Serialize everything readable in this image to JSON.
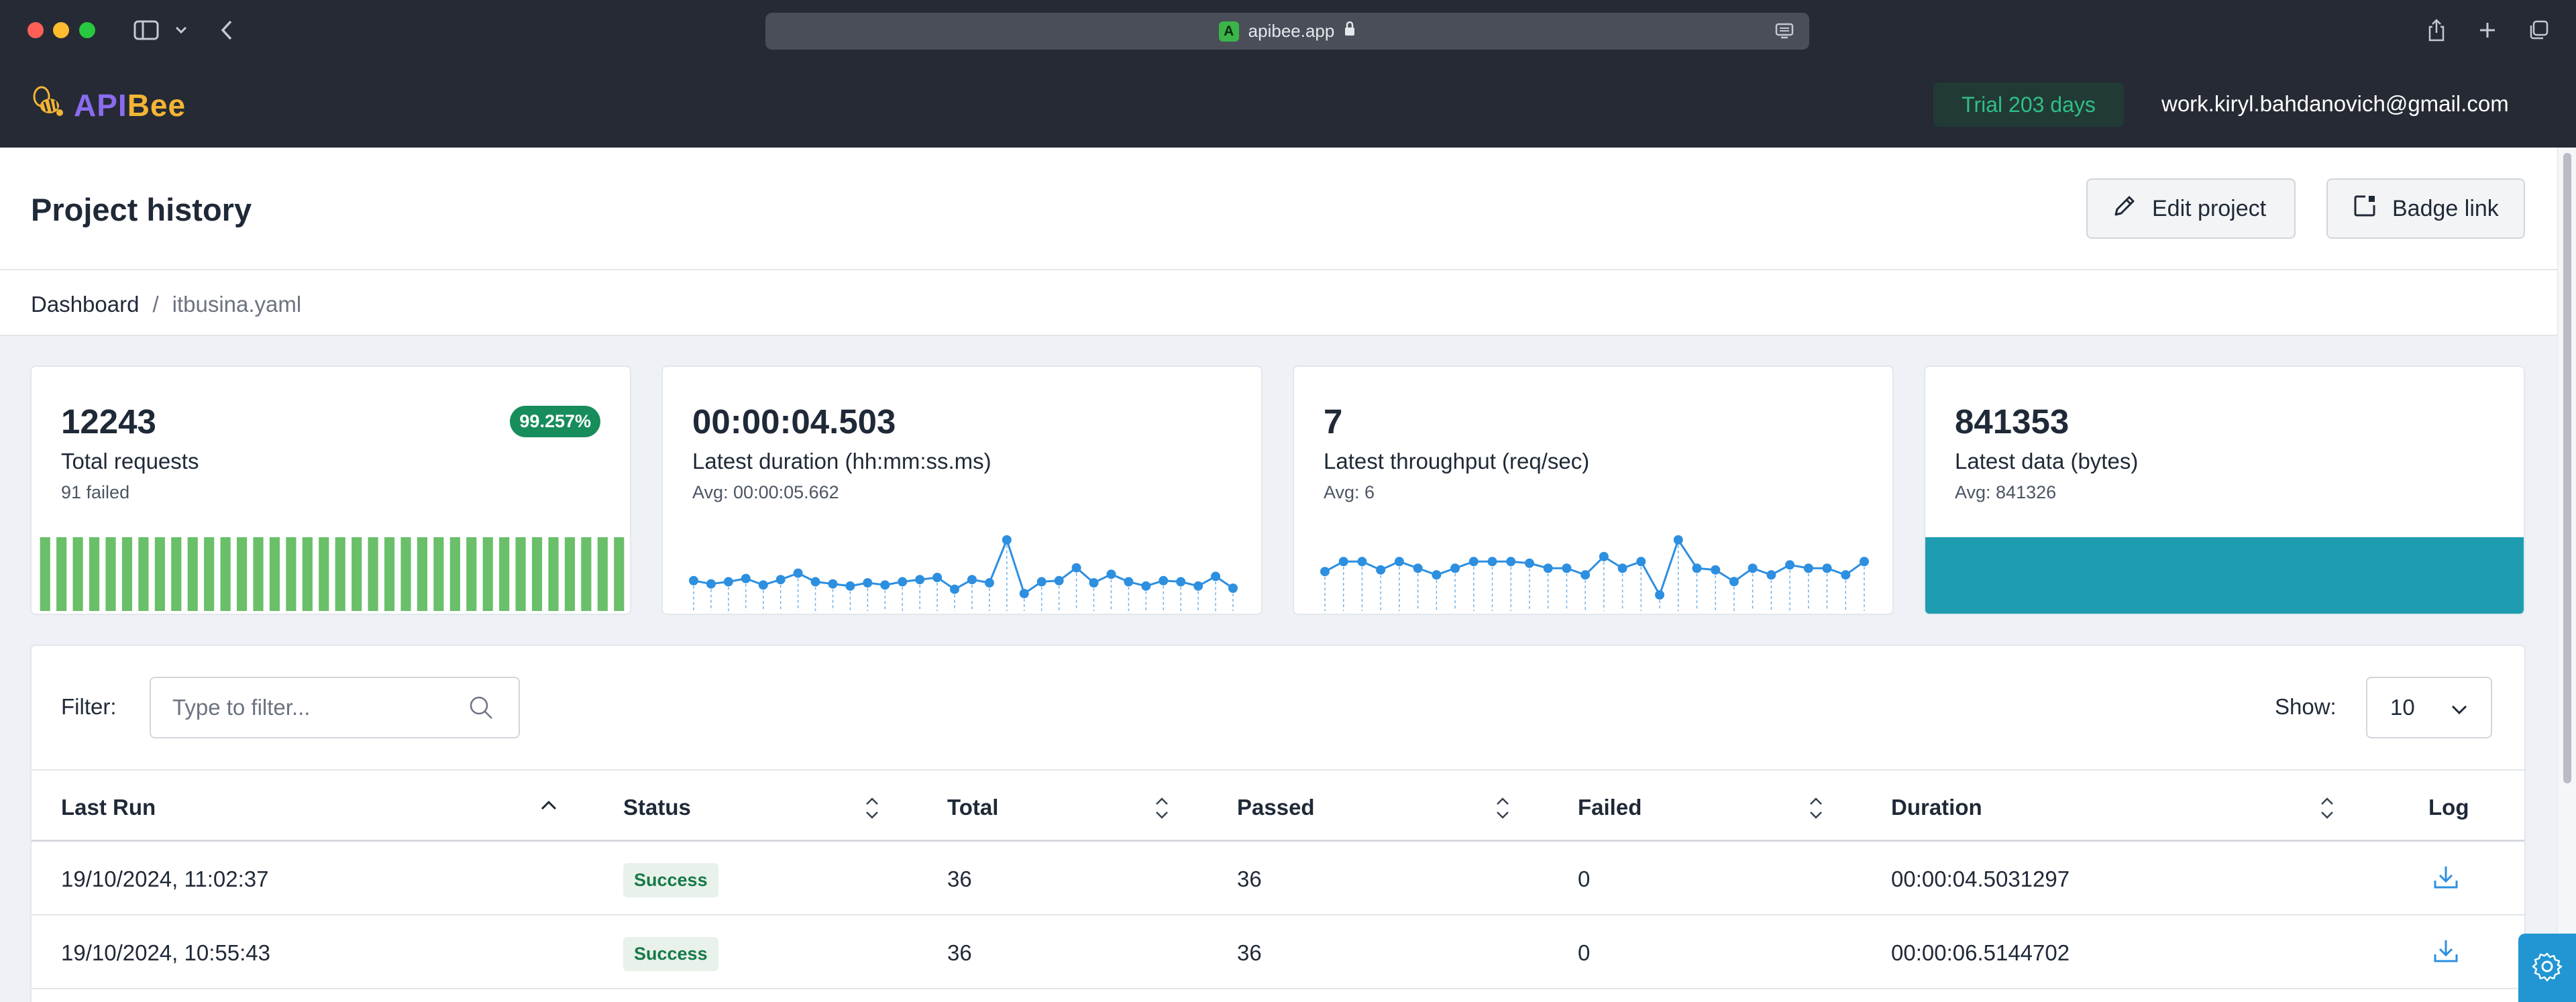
{
  "browser": {
    "url": "apibee.app",
    "site_badge": "A"
  },
  "app": {
    "logo_api": "API",
    "logo_bee": "Bee",
    "trial": "Trial 203 days",
    "email": "work.kiryl.bahdanovich@gmail.com"
  },
  "page": {
    "title": "Project history",
    "edit_label": "Edit project",
    "badge_label": "Badge link"
  },
  "breadcrumb": {
    "home": "Dashboard",
    "sep": "/",
    "current": "itbusina.yaml"
  },
  "cards": {
    "requests": {
      "value": "12243",
      "label": "Total requests",
      "sub": "91 failed",
      "badge": "99.257%"
    },
    "duration": {
      "value": "00:00:04.503",
      "label": "Latest duration (hh:mm:ss.ms)",
      "sub": "Avg: 00:00:05.662"
    },
    "throughput": {
      "value": "7",
      "label": "Latest throughput (req/sec)",
      "sub": "Avg: 6"
    },
    "data": {
      "value": "841353",
      "label": "Latest data (bytes)",
      "sub": "Avg: 841326"
    }
  },
  "chart_data": [
    {
      "type": "bar",
      "name": "requests",
      "values": [
        1,
        1,
        1,
        1,
        1,
        1,
        1,
        1,
        1,
        1,
        1,
        1,
        1,
        1,
        1,
        1,
        1,
        1,
        1,
        1,
        1,
        1,
        1,
        1,
        1,
        1,
        1,
        1,
        1,
        1,
        1,
        1,
        1,
        1,
        1,
        1
      ],
      "color": "#6abf69"
    },
    {
      "type": "line",
      "name": "duration",
      "values": [
        5.2,
        4.9,
        5.1,
        5.4,
        4.8,
        5.3,
        5.9,
        5.1,
        4.9,
        4.7,
        5.0,
        4.8,
        5.1,
        5.3,
        5.5,
        4.4,
        5.3,
        5.0,
        9.0,
        4.0,
        5.1,
        5.2,
        6.4,
        5.0,
        5.8,
        5.1,
        4.7,
        5.2,
        5.1,
        4.7,
        5.6,
        4.5
      ],
      "color": "#2d8fe0"
    },
    {
      "type": "line",
      "name": "throughput",
      "values": [
        6,
        6.6,
        6.6,
        6.1,
        6.6,
        6.2,
        5.8,
        6.2,
        6.6,
        6.6,
        6.6,
        6.5,
        6.2,
        6.2,
        5.8,
        6.9,
        6.2,
        6.6,
        4.6,
        7.9,
        6.2,
        6.1,
        5.4,
        6.2,
        5.8,
        6.4,
        6.2,
        6.2,
        5.8,
        6.6
      ],
      "color": "#2d8fe0"
    }
  ],
  "table": {
    "filter_label": "Filter:",
    "filter_placeholder": "Type to filter...",
    "show_label": "Show:",
    "show_value": "10",
    "columns": [
      "Last Run",
      "Status",
      "Total",
      "Passed",
      "Failed",
      "Duration",
      "Log"
    ],
    "rows": [
      {
        "last_run": "19/10/2024, 11:02:37",
        "status": "Success",
        "total": "36",
        "passed": "36",
        "failed": "0",
        "duration": "00:00:04.5031297"
      },
      {
        "last_run": "19/10/2024, 10:55:43",
        "status": "Success",
        "total": "36",
        "passed": "36",
        "failed": "0",
        "duration": "00:00:06.5144702"
      }
    ]
  },
  "colors": {
    "header_bg": "#262a34",
    "accent_teal": "#1e9db1",
    "success_green": "#178d5b",
    "link_blue": "#2d8fe0"
  }
}
